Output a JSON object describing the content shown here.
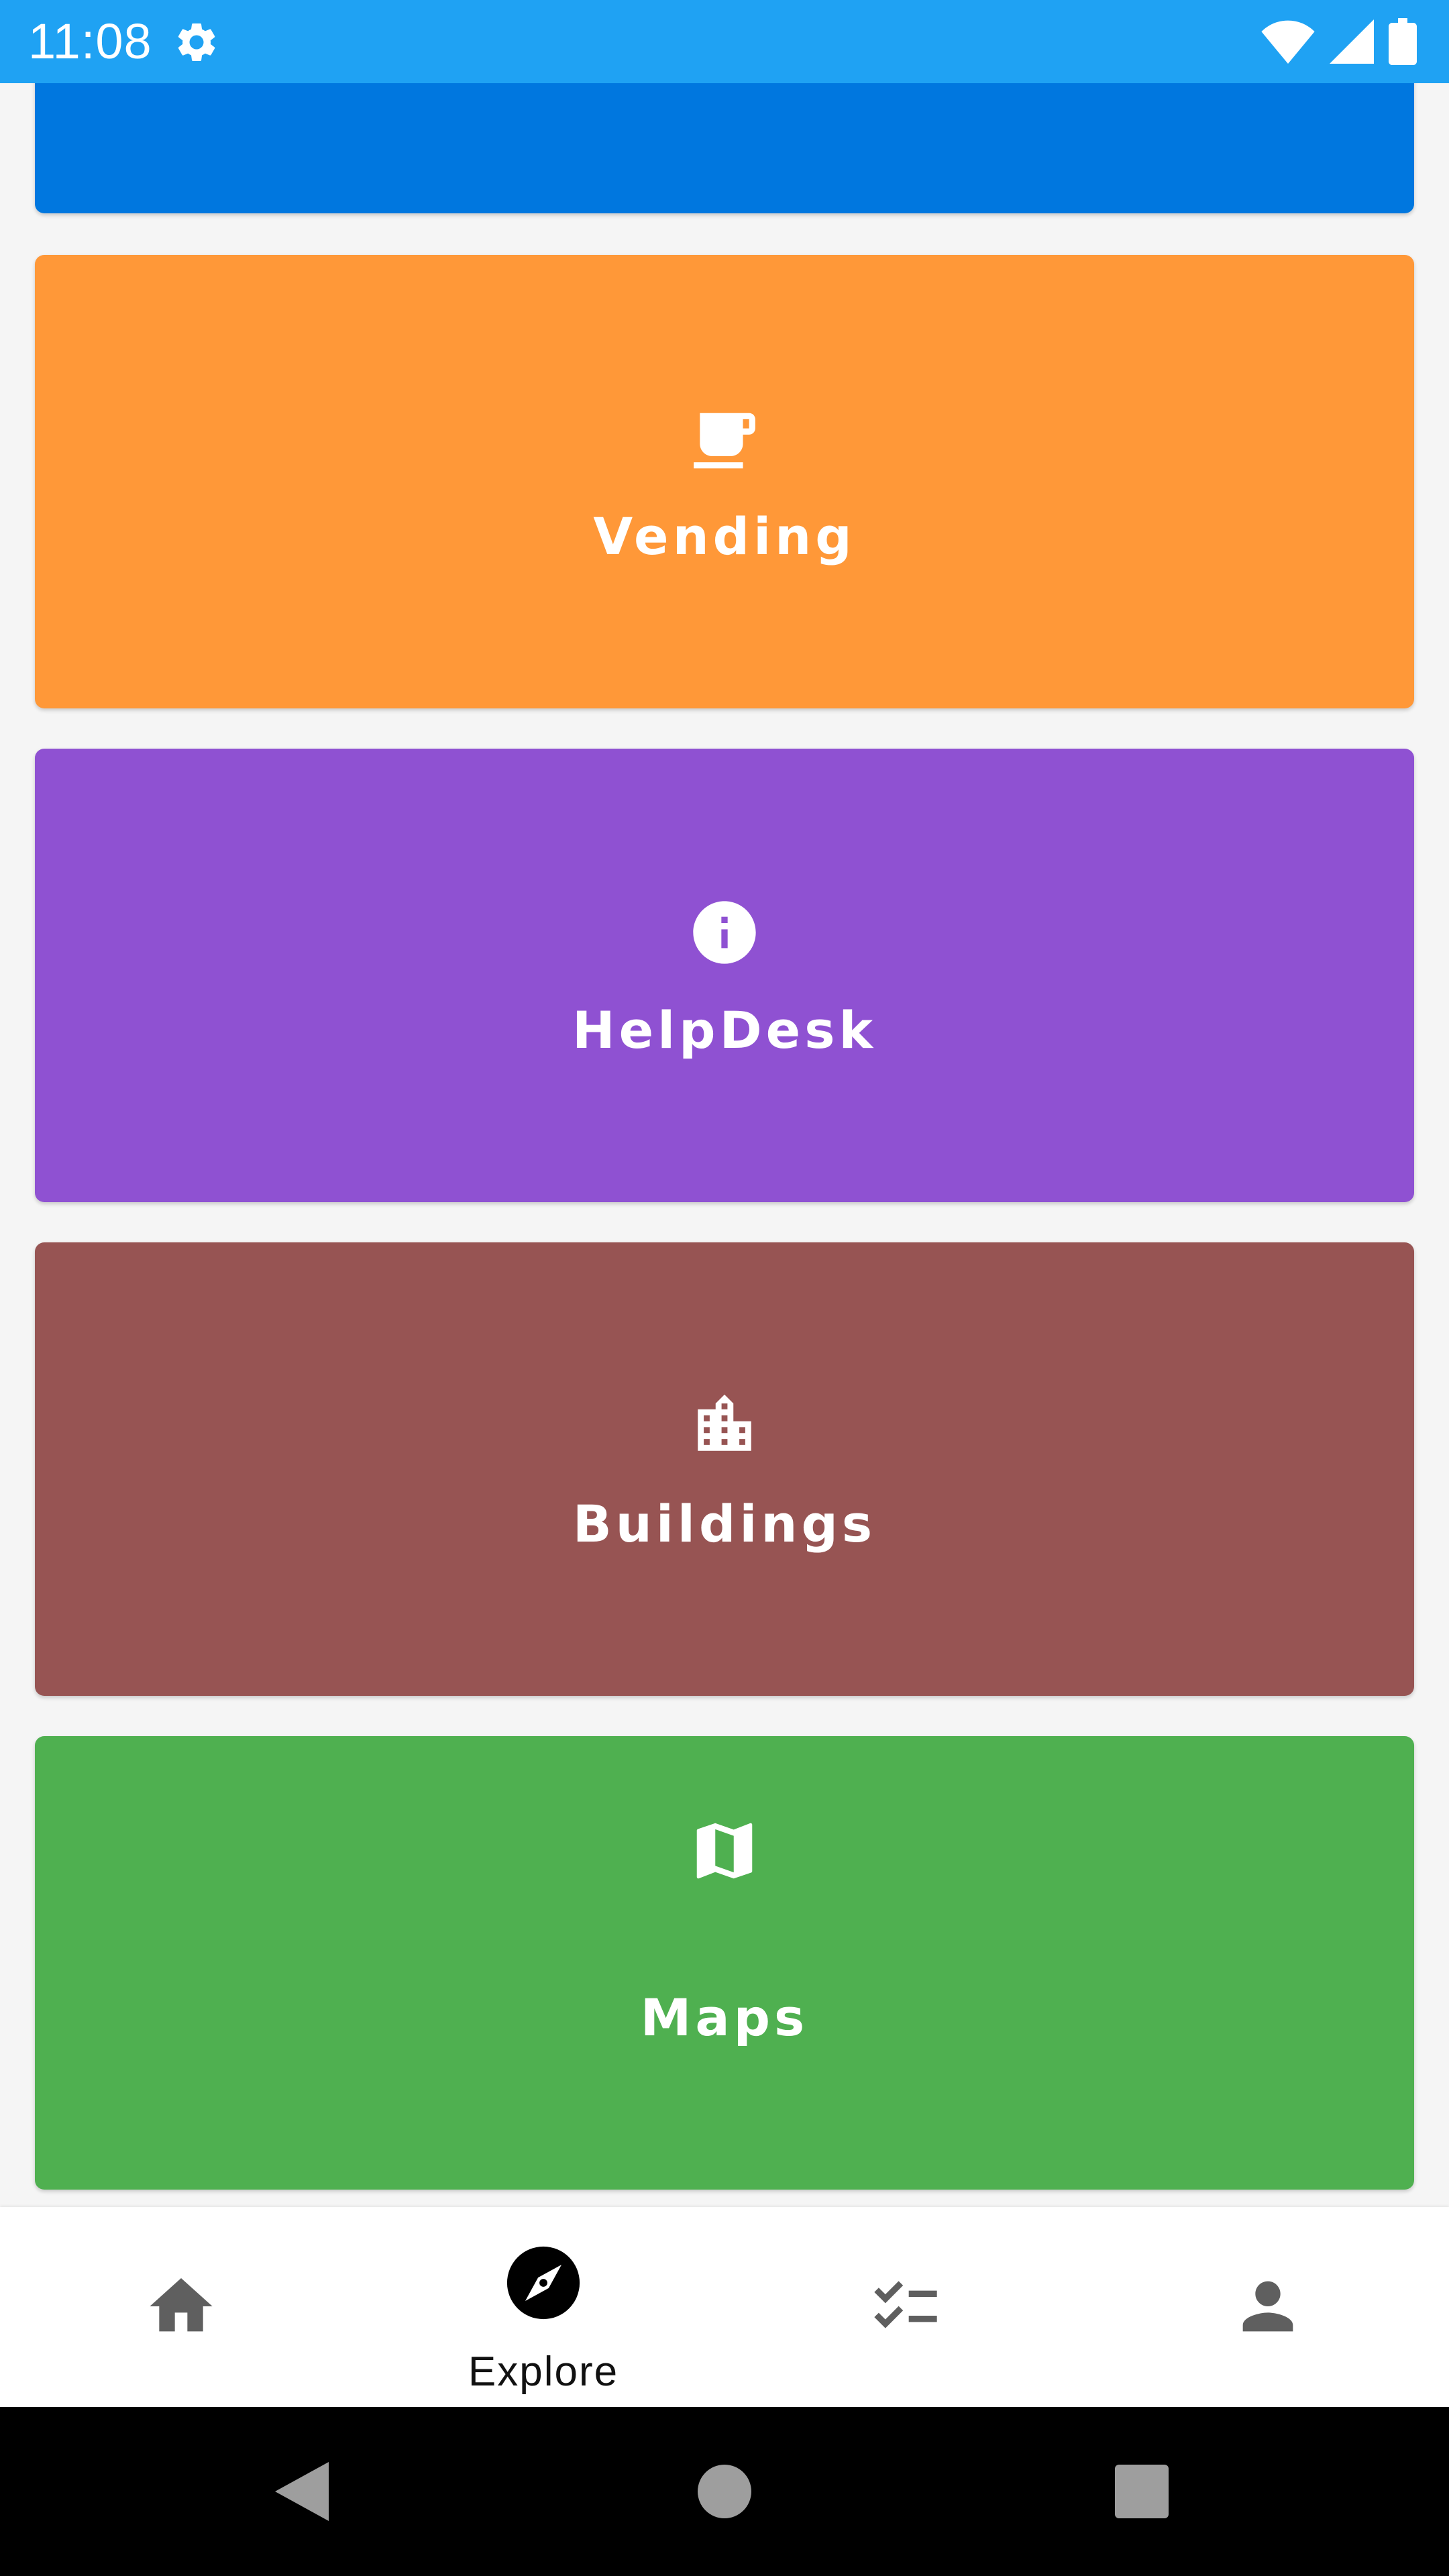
{
  "status_bar": {
    "time": "11:08",
    "icons": [
      "gear-icon",
      "wifi-icon",
      "cell-signal-icon",
      "battery-icon"
    ],
    "background": "#1fa2f3"
  },
  "tiles": [
    {
      "name": "top-partial",
      "label": "",
      "color": "#0077df",
      "icon": ""
    },
    {
      "name": "vending",
      "label": "Vending",
      "color": "#ff9838",
      "icon": "coffee-cup-icon"
    },
    {
      "name": "helpdesk",
      "label": "HelpDesk",
      "color": "#8f51d2",
      "icon": "info-icon"
    },
    {
      "name": "buildings",
      "label": "Buildings",
      "color": "#975453",
      "icon": "building-icon"
    },
    {
      "name": "maps",
      "label": "Maps",
      "color": "#4fb050",
      "icon": "map-icon"
    }
  ],
  "bottom_nav": {
    "items": [
      {
        "name": "home",
        "icon": "home-icon",
        "label": "",
        "selected": false
      },
      {
        "name": "explore",
        "icon": "compass-icon",
        "label": "Explore",
        "selected": true
      },
      {
        "name": "tasks",
        "icon": "checklist-icon",
        "label": "",
        "selected": false
      },
      {
        "name": "profile",
        "icon": "person-icon",
        "label": "",
        "selected": false
      }
    ]
  },
  "system_nav": {
    "buttons": [
      "back-icon",
      "home-circle-icon",
      "recents-icon"
    ]
  }
}
